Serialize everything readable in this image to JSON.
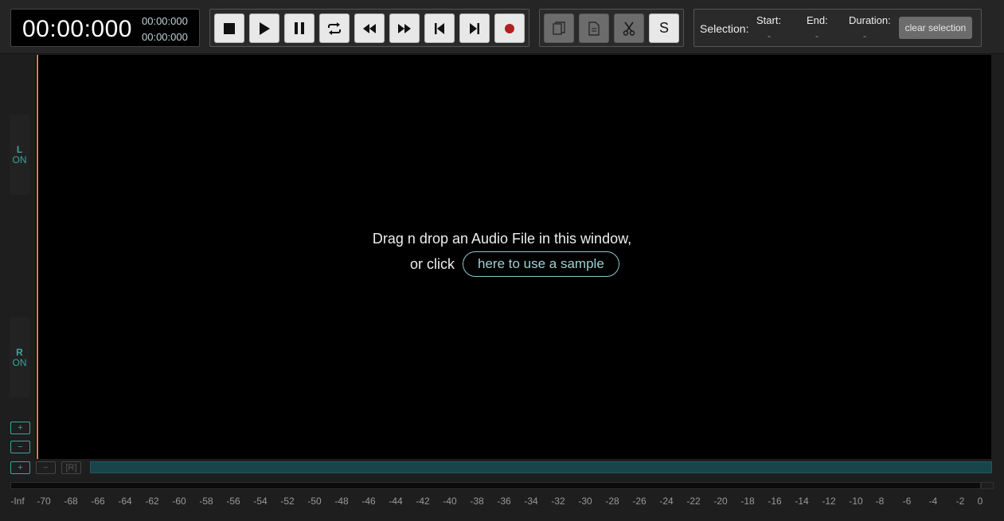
{
  "clock": {
    "main": "00:00:000",
    "top": "00:00:000",
    "bottom": "00:00:000"
  },
  "transport": [
    {
      "name": "stop-button",
      "icon": "stop-icon"
    },
    {
      "name": "play-button",
      "icon": "play-icon"
    },
    {
      "name": "pause-button",
      "icon": "pause-icon"
    },
    {
      "name": "loop-button",
      "icon": "loop-icon"
    },
    {
      "name": "rewind-button",
      "icon": "rewind-icon"
    },
    {
      "name": "fast-forward-button",
      "icon": "fast-forward-icon"
    },
    {
      "name": "skip-to-start-button",
      "icon": "skip-start-icon"
    },
    {
      "name": "skip-to-end-button",
      "icon": "skip-end-icon"
    },
    {
      "name": "record-button",
      "icon": "record-icon"
    }
  ],
  "edit": {
    "s_label": "S"
  },
  "selection": {
    "title": "Selection:",
    "start_label": "Start:",
    "start_value": "-",
    "end_label": "End:",
    "end_value": "-",
    "duration_label": "Duration:",
    "duration_value": "-",
    "clear_label": "clear selection"
  },
  "channels": {
    "left": {
      "letter": "L",
      "state": "ON"
    },
    "right": {
      "letter": "R",
      "state": "ON"
    }
  },
  "zoom": {
    "in": "+",
    "out": "−"
  },
  "overview": {
    "plus": "+",
    "minus": "−",
    "reset": "[R]"
  },
  "drop": {
    "line1": "Drag n drop an Audio File in this window,",
    "line2": "or click",
    "link": "here to use a sample"
  },
  "colors": {
    "accent": "#3fa29b",
    "cursor": "#d97a5a",
    "record": "#b02020"
  },
  "meter_scale": [
    "-Inf",
    "-70",
    "-68",
    "-66",
    "-64",
    "-62",
    "-60",
    "-58",
    "-56",
    "-54",
    "-52",
    "-50",
    "-48",
    "-46",
    "-44",
    "-42",
    "-40",
    "-38",
    "-36",
    "-34",
    "-32",
    "-30",
    "-28",
    "-26",
    "-24",
    "-22",
    "-20",
    "-18",
    "-16",
    "-14",
    "-12",
    "-10",
    "-8",
    "-6",
    "-4",
    "-2",
    "0"
  ]
}
